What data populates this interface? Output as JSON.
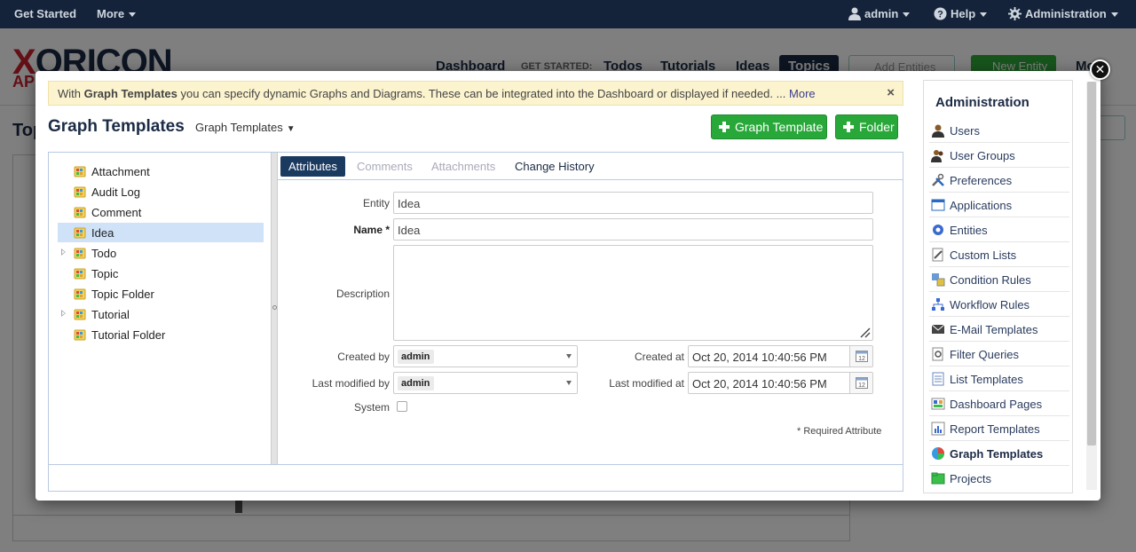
{
  "topbar": {
    "get_started": "Get Started",
    "more": "More",
    "user": "admin",
    "help": "Help",
    "administration": "Administration"
  },
  "background": {
    "logo": "XORICON",
    "logo_sub": "AP",
    "nav": [
      "Dashboard",
      "GET STARTED:",
      "Todos",
      "Tutorials",
      "Ideas",
      "Topics"
    ],
    "search_placeholder": "Add Entities",
    "new_entity": "New Entity",
    "more": "Mo",
    "page_title": "Top"
  },
  "modal": {
    "info": {
      "prefix": "With ",
      "bold": "Graph Templates",
      "suffix": " you can specify dynamic Graphs and Diagrams. These can be integrated into the Dashboard or displayed if needed. ... ",
      "more": "More",
      "close": "×"
    },
    "title": "Graph Templates",
    "selector": "Graph Templates",
    "buttons": {
      "graph_template": "Graph Template",
      "folder": "Folder"
    },
    "tree": [
      {
        "label": "Attachment",
        "expandable": false,
        "selected": false
      },
      {
        "label": "Audit Log",
        "expandable": false,
        "selected": false
      },
      {
        "label": "Comment",
        "expandable": false,
        "selected": false
      },
      {
        "label": "Idea",
        "expandable": false,
        "selected": true
      },
      {
        "label": "Todo",
        "expandable": true,
        "selected": false
      },
      {
        "label": "Topic",
        "expandable": false,
        "selected": false
      },
      {
        "label": "Topic Folder",
        "expandable": false,
        "selected": false
      },
      {
        "label": "Tutorial",
        "expandable": true,
        "selected": false
      },
      {
        "label": "Tutorial Folder",
        "expandable": false,
        "selected": false
      }
    ],
    "tabs": [
      "Attributes",
      "Comments",
      "Attachments",
      "Change History"
    ],
    "form": {
      "entity_label": "Entity",
      "entity_value": "Idea",
      "name_label": "Name *",
      "name_value": "Idea",
      "description_label": "Description",
      "created_by_label": "Created by",
      "created_by_value": "admin",
      "modified_by_label": "Last modified by",
      "modified_by_value": "admin",
      "created_at_label": "Created at",
      "created_at_value": "Oct 20, 2014 10:40:56 PM",
      "modified_at_label": "Last modified at",
      "modified_at_value": "Oct 20, 2014 10:40:56 PM",
      "system_label": "System",
      "required_note": "* Required Attribute"
    }
  },
  "admin": {
    "heading": "Administration",
    "items": [
      {
        "label": "Users",
        "icon": "user-icon"
      },
      {
        "label": "User Groups",
        "icon": "user-group-icon"
      },
      {
        "label": "Preferences",
        "icon": "tools-icon"
      },
      {
        "label": "Applications",
        "icon": "window-icon"
      },
      {
        "label": "Entities",
        "icon": "gear-icon"
      },
      {
        "label": "Custom Lists",
        "icon": "list-edit-icon"
      },
      {
        "label": "Condition Rules",
        "icon": "condition-icon"
      },
      {
        "label": "Workflow Rules",
        "icon": "workflow-icon"
      },
      {
        "label": "E-Mail Templates",
        "icon": "envelope-icon"
      },
      {
        "label": "Filter Queries",
        "icon": "filter-icon"
      },
      {
        "label": "List Templates",
        "icon": "list-icon"
      },
      {
        "label": "Dashboard Pages",
        "icon": "dashboard-icon"
      },
      {
        "label": "Report Templates",
        "icon": "report-icon"
      },
      {
        "label": "Graph Templates",
        "icon": "pie-chart-icon"
      },
      {
        "label": "Projects",
        "icon": "folder-icon"
      }
    ],
    "current": "Graph Templates"
  }
}
